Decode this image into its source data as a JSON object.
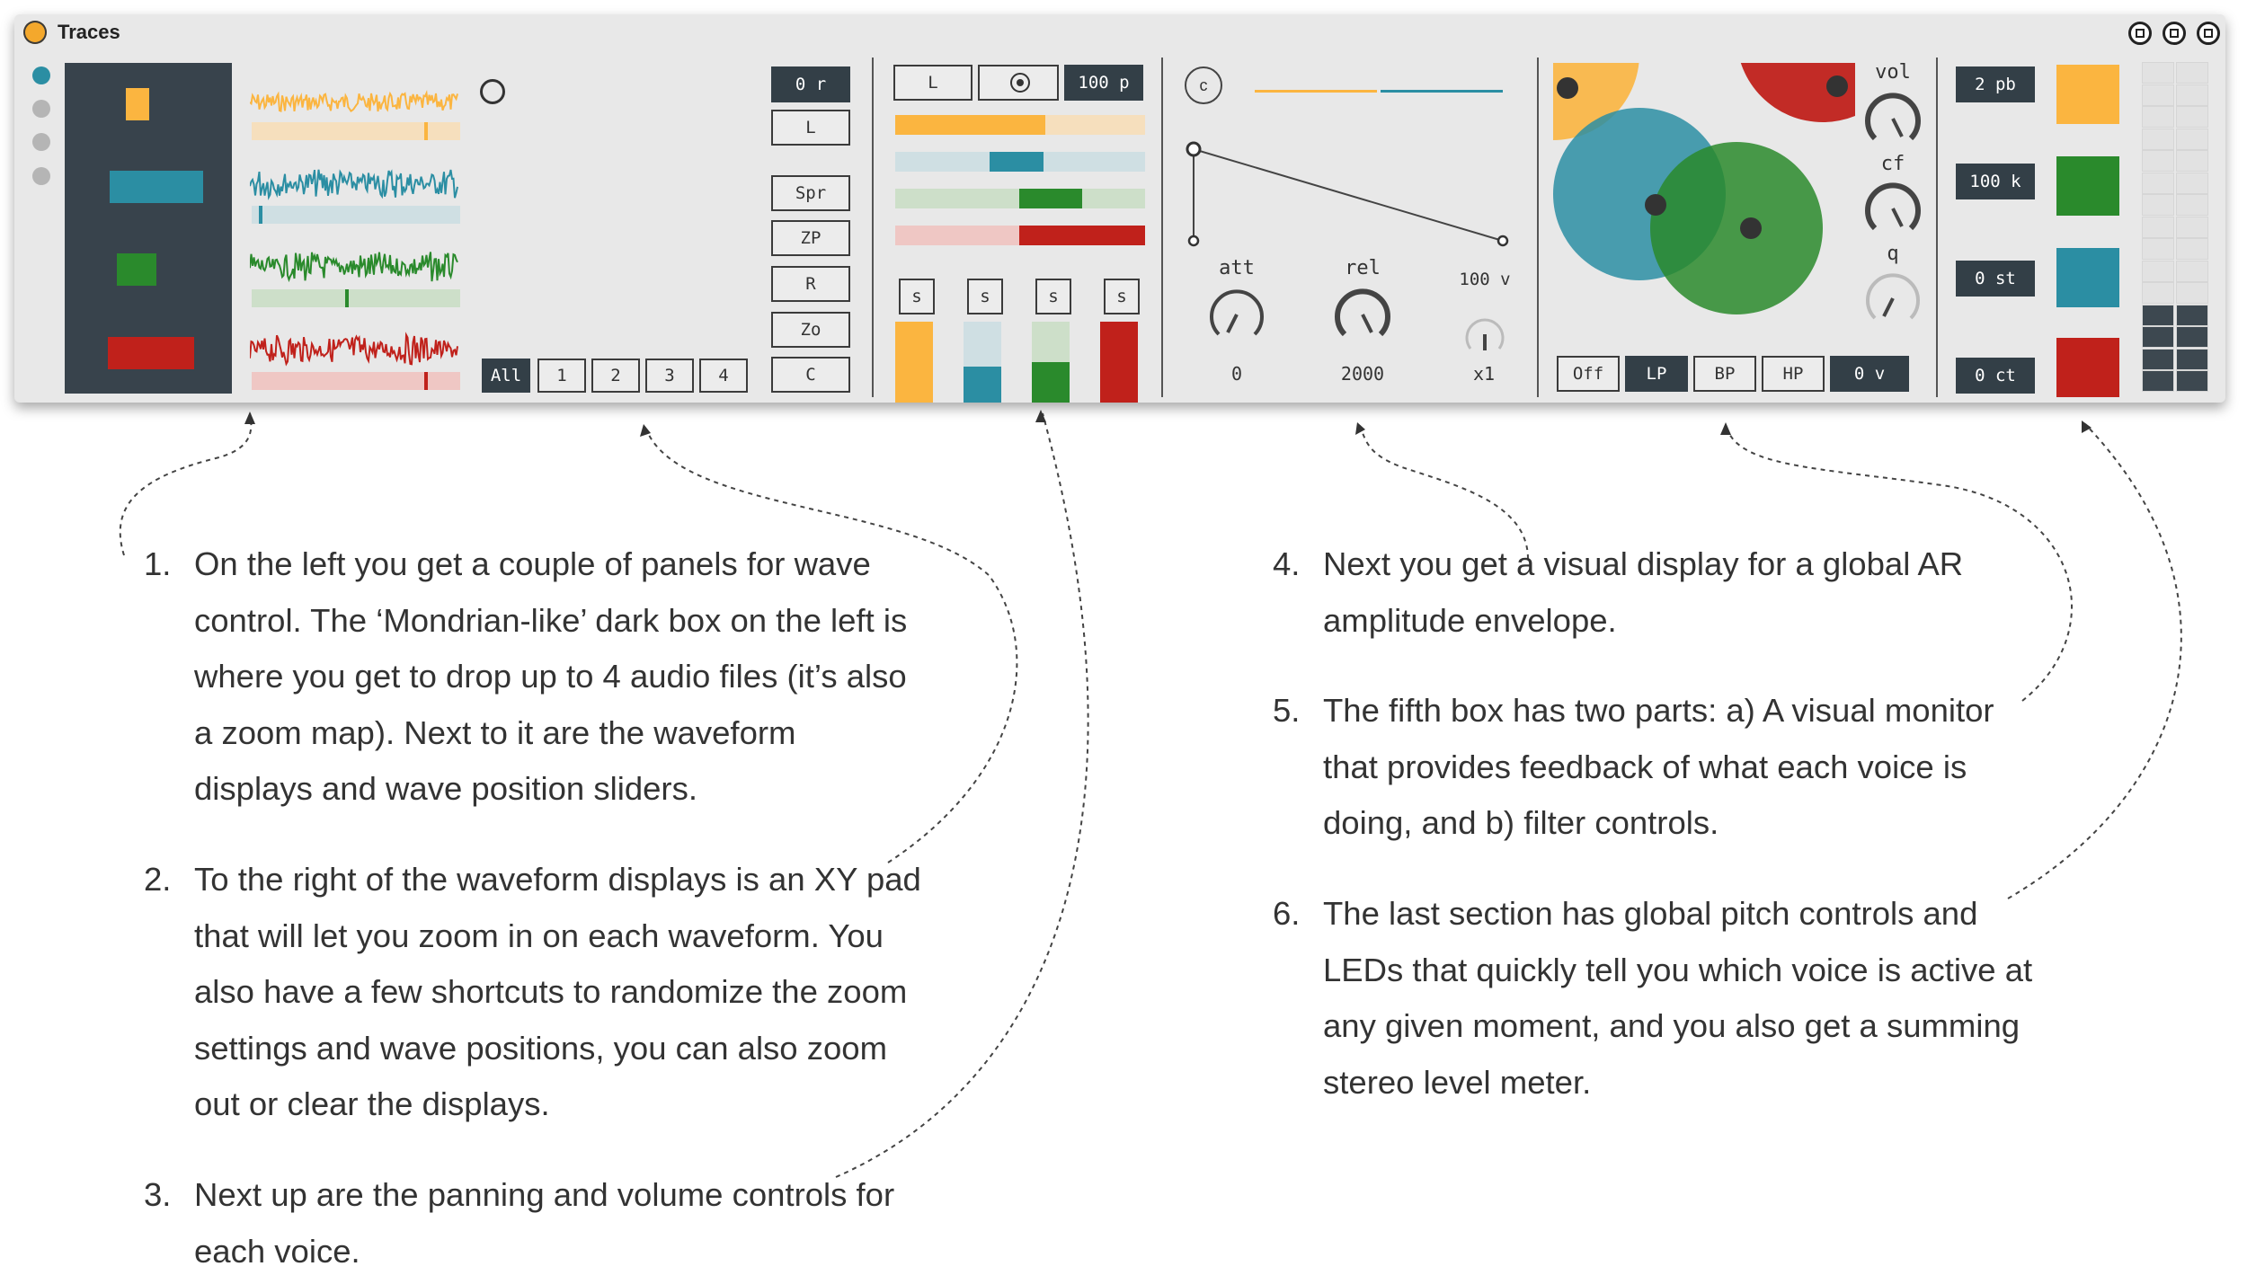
{
  "window": {
    "title": "Traces"
  },
  "xy_pad": {
    "shortcut_buttons": [
      "L",
      "Spr",
      "ZP",
      "R",
      "Zo",
      "C"
    ],
    "readout": "0 r",
    "voice_buttons": [
      "All",
      "1",
      "2",
      "3",
      "4"
    ]
  },
  "mixer": {
    "pan_mode": "L",
    "pan_value": "100 p",
    "solo_label": "s",
    "pan_levels": [
      0.6,
      0.55,
      0.75,
      0.5
    ],
    "volume_levels": [
      1.0,
      0.45,
      0.5,
      1.0
    ]
  },
  "envelope": {
    "clear_label": "c",
    "att_label": "att",
    "att_value": "0",
    "rel_label": "rel",
    "rel_value": "2000",
    "vel_value": "100 v",
    "mult_value": "x1"
  },
  "filter": {
    "vol_label": "vol",
    "cf_label": "cf",
    "q_label": "q",
    "modes": [
      "Off",
      "LP",
      "BP",
      "HP"
    ],
    "active_mode": "LP",
    "value": "0 v"
  },
  "pitch": {
    "values": [
      "2 pb",
      "100 k",
      "0 st",
      "0 ct"
    ]
  },
  "colors": {
    "yellow": "#fbb540",
    "teal": "#2b8ea3",
    "green": "#2a8a2c",
    "red": "#c0211b",
    "dark": "#38434c"
  },
  "notes": [
    {
      "num": "1.",
      "lines": [
        "On the left you get a couple of panels for wave",
        "control. The ‘Mondrian-like’ dark box on the left is",
        "where you get to drop up to 4 audio files (it’s also",
        "a zoom map). Next to it are the waveform",
        "displays and wave position sliders."
      ]
    },
    {
      "num": "2.",
      "lines": [
        "To the right of the waveform displays is an XY pad",
        "that will let you zoom in on each waveform. You",
        "also have a few shortcuts to randomize the zoom",
        "settings and wave positions, you can also zoom",
        "out or clear the displays."
      ]
    },
    {
      "num": "3.",
      "lines": [
        "Next up are the panning and volume controls for",
        "each voice."
      ]
    },
    {
      "num": "4.",
      "lines": [
        "Next you get a visual display for a global AR",
        "amplitude envelope."
      ]
    },
    {
      "num": "5.",
      "lines": [
        "The fifth box has two parts: a) A visual monitor",
        "that provides feedback of what each voice is",
        "doing, and b) filter controls."
      ]
    },
    {
      "num": "6.",
      "lines": [
        "The last section has global pitch controls and",
        "LEDs that quickly tell you which voice is active at",
        "any given moment, and you also get a summing",
        "stereo level meter."
      ]
    }
  ]
}
